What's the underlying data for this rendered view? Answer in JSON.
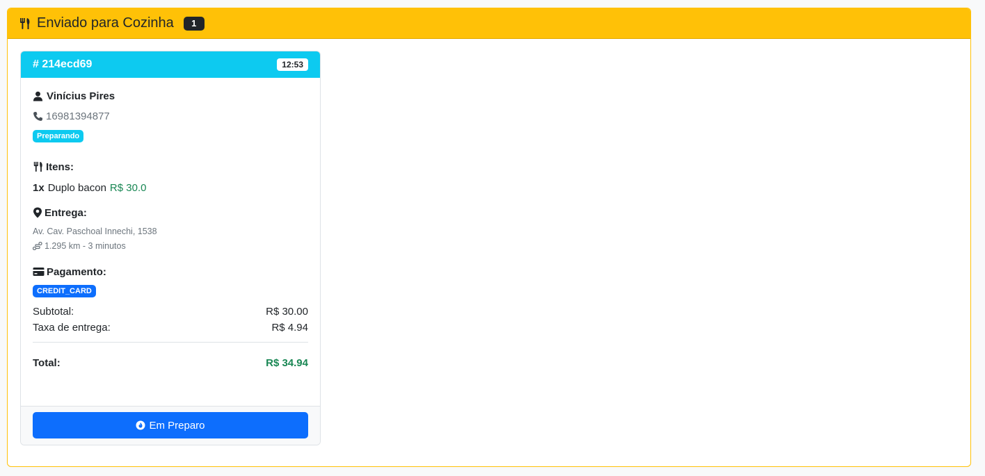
{
  "panel": {
    "title": "Enviado para Cozinha",
    "count": "1",
    "icon": "utensils-icon",
    "accent_color": "#ffc107"
  },
  "order": {
    "id": "# 214ecd69",
    "time": "12:53",
    "header_color": "#0dcaf0",
    "customer": {
      "name": "Vinícius Pires",
      "phone": "16981394877"
    },
    "status": "Preparando",
    "items_title": "Itens:",
    "items": [
      {
        "qty": "1x",
        "name": "Duplo bacon",
        "price": "R$ 30.0"
      }
    ],
    "delivery_title": "Entrega:",
    "address": "Av. Cav. Paschoal Innechi, 1538",
    "distance": "1.295 km - 3 minutos",
    "payment_title": "Pagamento:",
    "payment_method": "CREDIT_CARD",
    "subtotal_label": "Subtotal:",
    "subtotal_value": "R$ 30.00",
    "fee_label": "Taxa de entrega:",
    "fee_value": "R$ 4.94",
    "total_label": "Total:",
    "total_value": "R$ 34.94",
    "action_label": "Em Preparo"
  }
}
